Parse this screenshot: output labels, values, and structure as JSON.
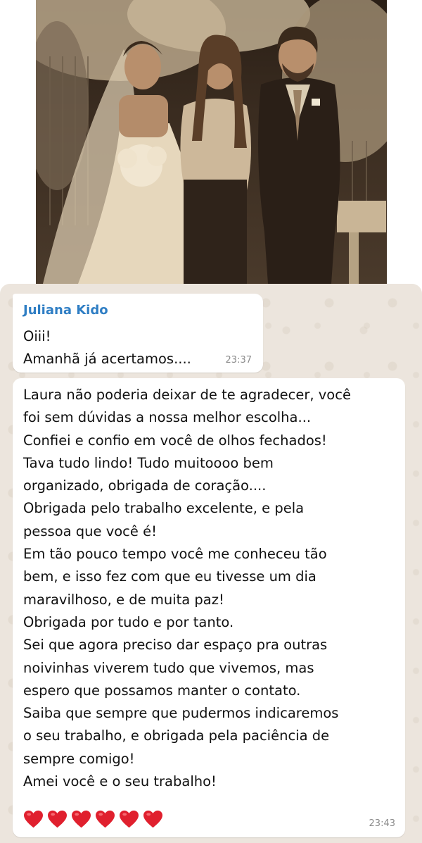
{
  "photo": {
    "description_icon": "wedding-photo-image"
  },
  "chat": {
    "messages": [
      {
        "sender": "Juliana Kido",
        "lines": [
          "Oiii!",
          "Amanhã já acertamos...."
        ],
        "time": "23:37"
      },
      {
        "lines": [
          "Laura não poderia deixar de te agradecer, você",
          "foi sem dúvidas a nossa melhor escolha...",
          "Confiei e confio em você de olhos fechados!",
          "Tava tudo lindo! Tudo muitoooo bem",
          "organizado, obrigada de coração....",
          "Obrigada pelo trabalho excelente, e pela",
          "pessoa que você é!",
          "Em tão pouco tempo você me conheceu tão",
          "bem, e isso fez com que eu tivesse um dia",
          "maravilhoso, e de muita paz!",
          "Obrigada por tudo e por tanto.",
          "Sei que agora preciso dar espaço pra outras",
          "noivinhas viverem tudo que vivemos, mas",
          "espero que possamos manter o contato.",
          "Saiba que sempre que pudermos indicaremos",
          "o seu trabalho, e obrigada pela paciência de",
          "sempre comigo!",
          "Amei você e o seu trabalho!"
        ],
        "hearts": 6,
        "heart_color": "#e0202e",
        "time": "23:43"
      }
    ]
  }
}
